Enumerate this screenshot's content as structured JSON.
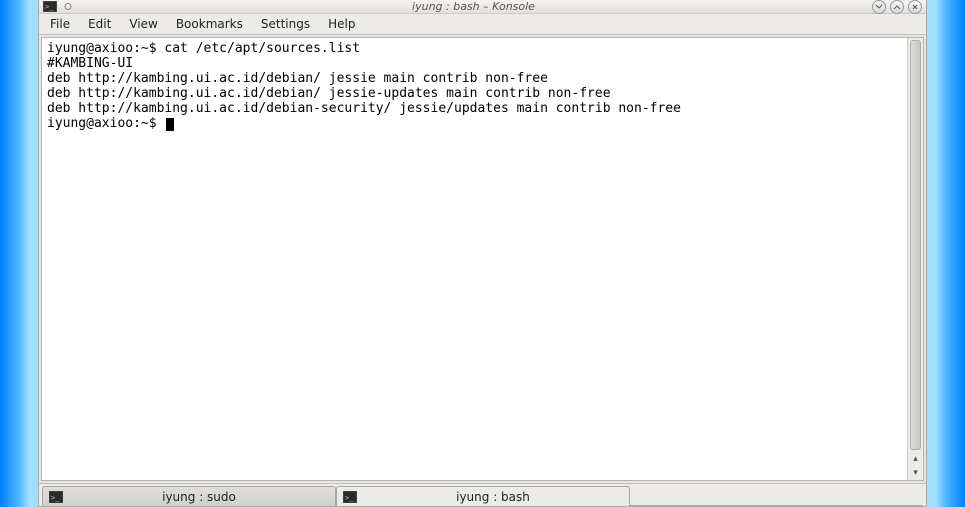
{
  "window": {
    "title": "iyung : bash – Konsole"
  },
  "menu": {
    "file": "File",
    "edit": "Edit",
    "view": "View",
    "bookmarks": "Bookmarks",
    "settings": "Settings",
    "help": "Help"
  },
  "terminal": {
    "lines": [
      "iyung@axioo:~$ cat /etc/apt/sources.list",
      "#KAMBING-UI",
      "deb http://kambing.ui.ac.id/debian/ jessie main contrib non-free",
      "deb http://kambing.ui.ac.id/debian/ jessie-updates main contrib non-free",
      "deb http://kambing.ui.ac.id/debian-security/ jessie/updates main contrib non-free"
    ],
    "prompt": "iyung@axioo:~$ "
  },
  "tabs": [
    {
      "label": "iyung : sudo",
      "active": false
    },
    {
      "label": "iyung : bash",
      "active": true
    }
  ]
}
